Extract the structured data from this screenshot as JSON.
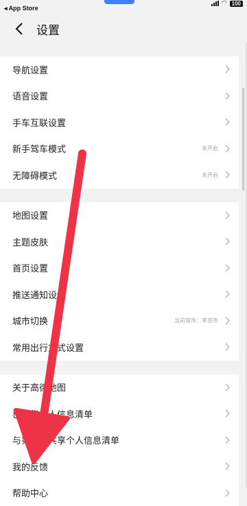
{
  "status_bar": {
    "back_label": "◂ App Store",
    "battery": "100"
  },
  "nav": {
    "title": "设置"
  },
  "groups": [
    {
      "items": [
        {
          "label": "导航设置",
          "value": ""
        },
        {
          "label": "语音设置",
          "value": ""
        },
        {
          "label": "手车互联设置",
          "value": ""
        },
        {
          "label": "新手驾车模式",
          "value": "未开启"
        },
        {
          "label": "无障碍模式",
          "value": "未开启"
        }
      ]
    },
    {
      "items": [
        {
          "label": "地图设置",
          "value": ""
        },
        {
          "label": "主题皮肤",
          "value": ""
        },
        {
          "label": "首页设置",
          "value": ""
        },
        {
          "label": "推送通知设置",
          "value": ""
        },
        {
          "label": "城市切换",
          "value": "当前城市：孝感市"
        },
        {
          "label": "常用出行方式设置",
          "value": ""
        }
      ]
    },
    {
      "items": [
        {
          "label": "关于高德地图",
          "value": ""
        },
        {
          "label": "已收集个人信息清单",
          "value": ""
        },
        {
          "label": "与第三方共享个人信息清单",
          "value": ""
        },
        {
          "label": "我的反馈",
          "value": ""
        },
        {
          "label": "帮助中心",
          "value": ""
        }
      ]
    }
  ],
  "colors": {
    "annotation_arrow": "#ee3346",
    "background": "#f2f2f2"
  }
}
